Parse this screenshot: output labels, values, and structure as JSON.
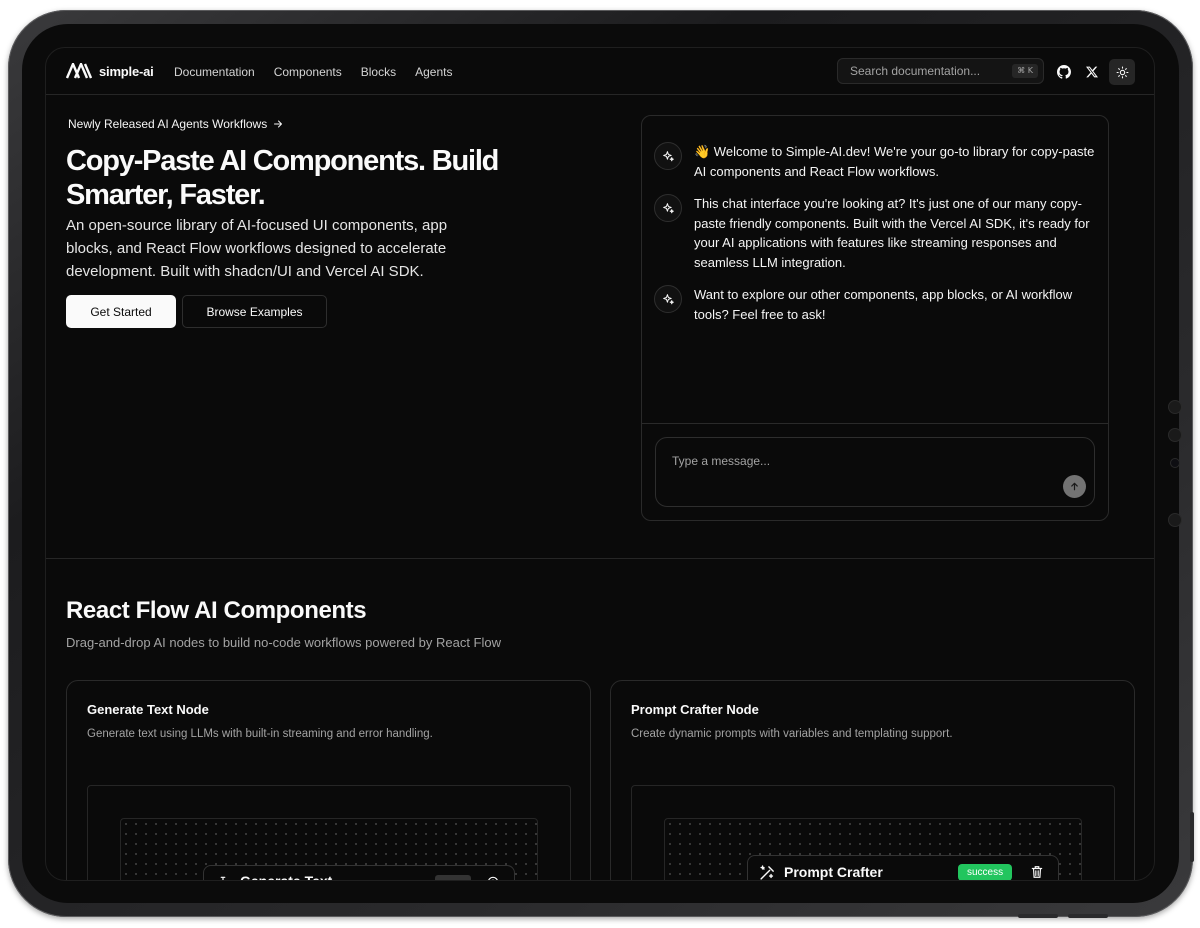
{
  "nav": {
    "brand": "simple-ai",
    "links": [
      "Documentation",
      "Components",
      "Blocks",
      "Agents"
    ],
    "search_placeholder": "Search documentation...",
    "search_shortcut": "⌘ K"
  },
  "hero": {
    "announcement": "Newly Released AI Agents Workflows",
    "title": "Copy-Paste AI Components. Build Smarter, Faster.",
    "description": "An open-source library of AI-focused UI components, app blocks, and React Flow workflows designed to accelerate development. Built with shadcn/UI and Vercel AI SDK.",
    "primary_cta": "Get Started",
    "secondary_cta": "Browse Examples"
  },
  "chat": {
    "messages": [
      "👋 Welcome to Simple-AI.dev! We're your go-to library for copy-paste AI components and React Flow workflows.",
      "This chat interface you're looking at? It's just one of our many copy-paste friendly components. Built with the Vercel AI SDK, it's ready for your AI applications with features like streaming responses and seamless LLM integration.",
      "Want to explore our other components, app blocks, or AI workflow tools? Feel free to ask!"
    ],
    "input_placeholder": "Type a message..."
  },
  "react_flow": {
    "title": "React Flow AI Components",
    "subtitle": "Drag-and-drop AI nodes to build no-code workflows powered by React Flow",
    "cards": [
      {
        "title": "Generate Text Node",
        "description": "Generate text using LLMs with built-in streaming and error handling.",
        "node_title": "Generate Text"
      },
      {
        "title": "Prompt Crafter Node",
        "description": "Create dynamic prompts with variables and templating support.",
        "node_title": "Prompt Crafter",
        "node_status": "success"
      }
    ]
  },
  "colors": {
    "background": "#0a0a0a",
    "foreground": "#fafafa",
    "muted": "#a3a3a3",
    "border": "#262626",
    "success": "#22c55e"
  },
  "icons": [
    "logo-mark",
    "arrow-right-icon",
    "github-icon",
    "x-icon",
    "sun-icon",
    "sparkles-icon",
    "arrow-up-icon",
    "wand-icon",
    "trash-icon",
    "text-cursor-icon",
    "settings-icon"
  ]
}
